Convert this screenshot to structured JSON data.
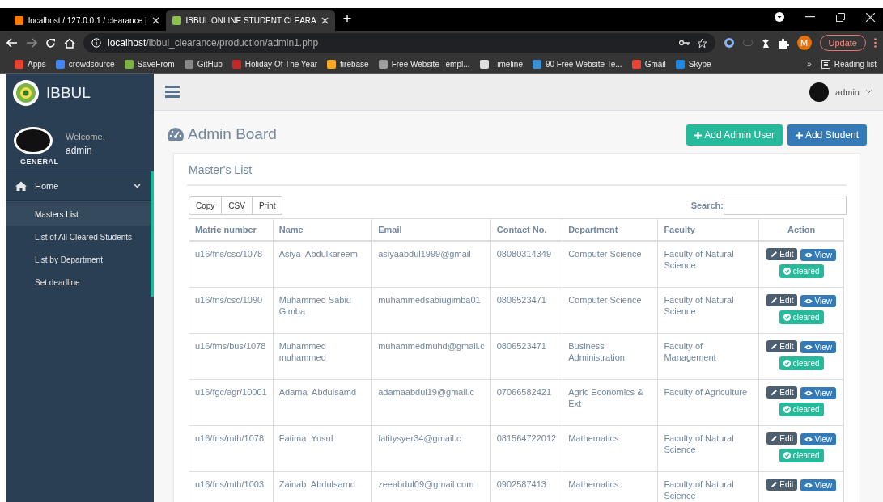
{
  "browser": {
    "tabs": [
      {
        "title": "localhost / 127.0.0.1 / clearance |",
        "selected": false
      },
      {
        "title": "IBBUL ONLINE STUDENT CLEARA",
        "selected": true
      }
    ],
    "new_tab": "+",
    "url_host": "localhost",
    "url_path": "/ibbul_clearance/production/admin1.php",
    "profile_initial": "M",
    "update_label": "Update",
    "bookmarks": [
      "Apps",
      "crowdsource",
      "SaveFrom",
      "GitHub",
      "Holiday Of The Year",
      "firebase",
      "Free Website Templ...",
      "Timeline",
      "90 Free Website Te...",
      "Gmail",
      "Skype"
    ],
    "more": "»",
    "reading_list": "Reading list"
  },
  "sidebar": {
    "brand": "IBBUL",
    "welcome": "Welcome,",
    "user": "admin",
    "section": "GENERAL",
    "menu": {
      "label": "Home",
      "expanded": true,
      "items": [
        {
          "label": "Masters List",
          "selected": true
        },
        {
          "label": "List of All Cleared Students",
          "selected": false
        },
        {
          "label": "List by Department",
          "selected": false
        },
        {
          "label": "Set deadline",
          "selected": false
        }
      ]
    }
  },
  "topbar": {
    "user": "admin"
  },
  "page": {
    "title": "Admin Board",
    "buttons": [
      {
        "label": "Add Admin User",
        "kind": "success"
      },
      {
        "label": "Add Student",
        "kind": "primary"
      }
    ],
    "panel": {
      "title": "Master's List",
      "export_buttons": [
        "Copy",
        "CSV",
        "Print"
      ],
      "search_label": "Search:",
      "table": {
        "columns": [
          "Matric number",
          "Name",
          "Email",
          "Contact No.",
          "Department",
          "Faculty",
          "Action"
        ],
        "rows": [
          {
            "cells": [
              "u16/fns/csc/1078",
              "Asiya  Abdulkareem",
              "asiyaabdul1999@gmail",
              "08080314349",
              "Computer Science",
              "Faculty of Natural Science"
            ],
            "actions": [
              "Edit",
              "View"
            ],
            "status": "cleared"
          },
          {
            "cells": [
              "u16/fns/csc/1090",
              "Muhammed Sabiu Gimba",
              "muhammedsabiugimba01",
              "0806523471",
              "Computer Science",
              "Faculty of Natural Science"
            ],
            "actions": [
              "Edit",
              "View"
            ],
            "status": "cleared"
          },
          {
            "cells": [
              "u16/fms/bus/1078",
              "Muhammed  muhammed",
              "muhammedmuhd@gmail.c",
              "0806523471",
              "Business Administration",
              "Faculty of Management"
            ],
            "actions": [
              "Edit",
              "View"
            ],
            "status": "cleared"
          },
          {
            "cells": [
              "u16/fgc/agr/10001",
              "Adama  Abdulsamd",
              "adamaabdul19@gmail.c",
              "07066582421",
              "Agric Economics & Ext",
              "Faculty of Agriculture"
            ],
            "actions": [
              "Edit",
              "View"
            ],
            "status": "cleared"
          },
          {
            "cells": [
              "u16/fns/mth/1078",
              "Fatima  Yusuf",
              "fatitysyer34@gmail.c",
              "081564722012",
              "Mathematics",
              "Faculty of Natural Science"
            ],
            "actions": [
              "Edit",
              "View"
            ],
            "status": "cleared"
          },
          {
            "cells": [
              "u16/fns/mth/1003",
              "Zainab  Abdulsamd",
              "zeeabdul09@gmail.com",
              "0902587413",
              "Mathematics",
              "Faculty of Natural Science"
            ],
            "actions": [
              "Edit",
              "View"
            ]
          }
        ]
      }
    }
  }
}
